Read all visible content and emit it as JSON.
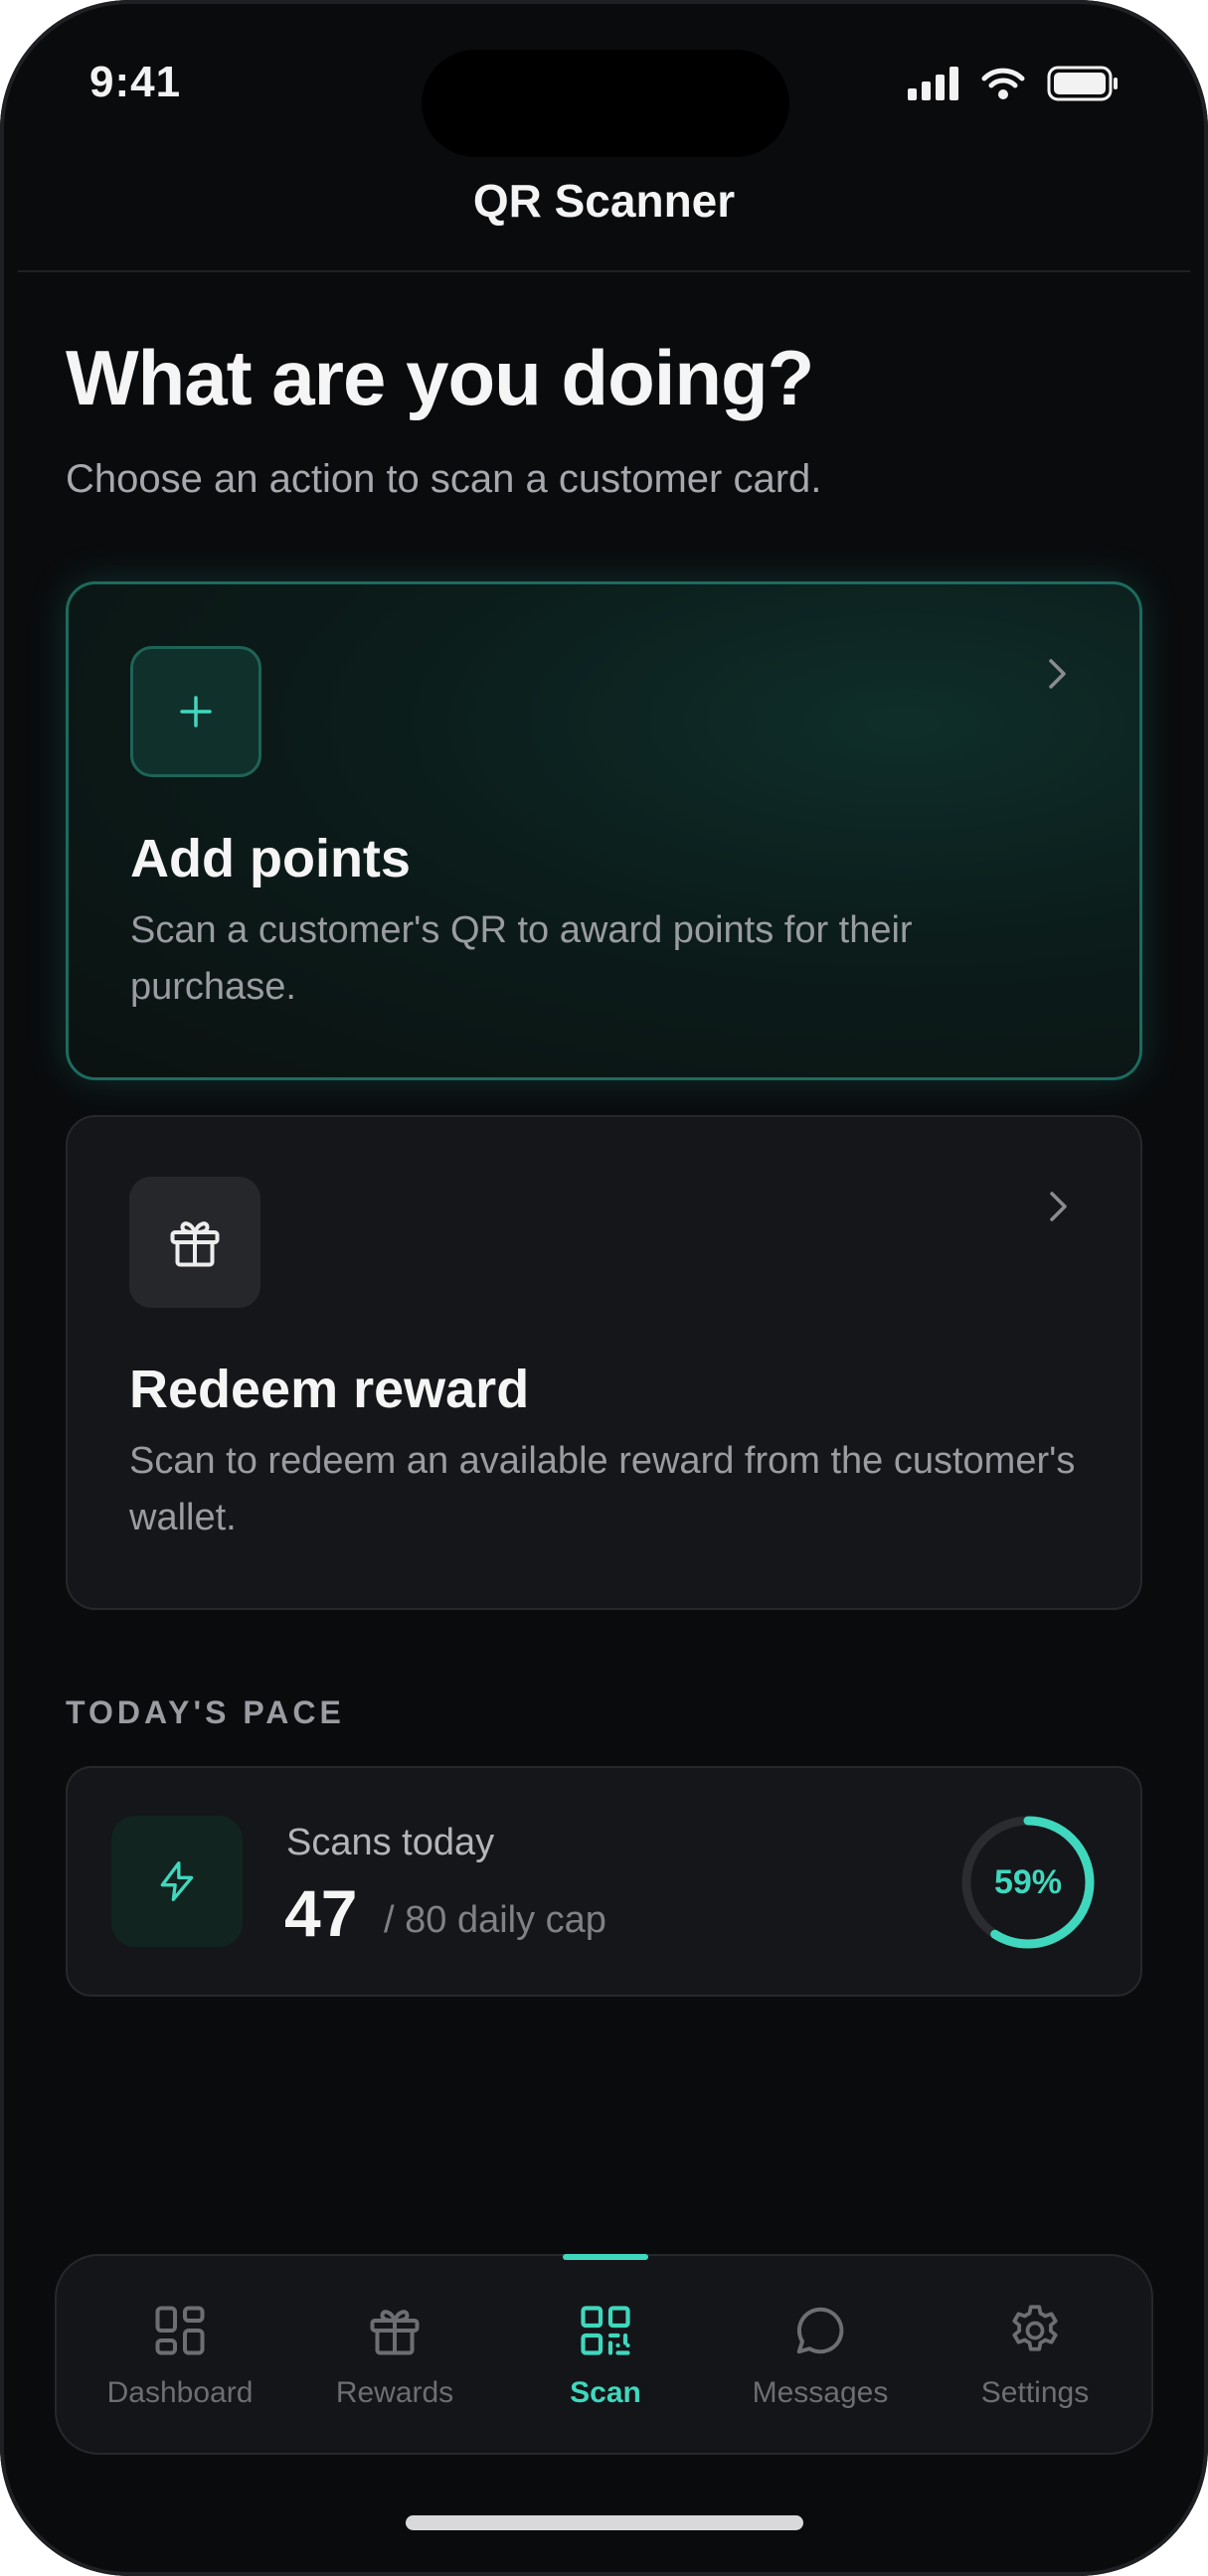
{
  "status_bar": {
    "time": "9:41"
  },
  "header": {
    "title": "QR Scanner"
  },
  "main": {
    "headline": "What are you doing?",
    "subhead": "Choose an action to scan a customer card.",
    "actions": [
      {
        "icon": "plus-icon",
        "title": "Add points",
        "description": "Scan a customer's QR to award points for their purchase.",
        "selected": true
      },
      {
        "icon": "gift-icon",
        "title": "Redeem reward",
        "description": "Scan to redeem an available reward from the customer's wallet.",
        "selected": false
      }
    ],
    "pace": {
      "section_label": "TODAY'S PACE",
      "label": "Scans today",
      "count": "47",
      "cap_text": "/ 80 daily cap",
      "percent_label": "59%",
      "progress": 0.59
    }
  },
  "tab_bar": {
    "items": [
      {
        "label": "Dashboard",
        "icon": "dashboard-icon",
        "active": false
      },
      {
        "label": "Rewards",
        "icon": "gift-icon",
        "active": false
      },
      {
        "label": "Scan",
        "icon": "qr-code-icon",
        "active": true
      },
      {
        "label": "Messages",
        "icon": "chat-bubble-icon",
        "active": false
      },
      {
        "label": "Settings",
        "icon": "gear-icon",
        "active": false
      }
    ]
  },
  "colors": {
    "accent": "#3fd8be",
    "background": "#0a0b0d",
    "card": "#151619",
    "card_border_selected": "#1c6b5f"
  }
}
